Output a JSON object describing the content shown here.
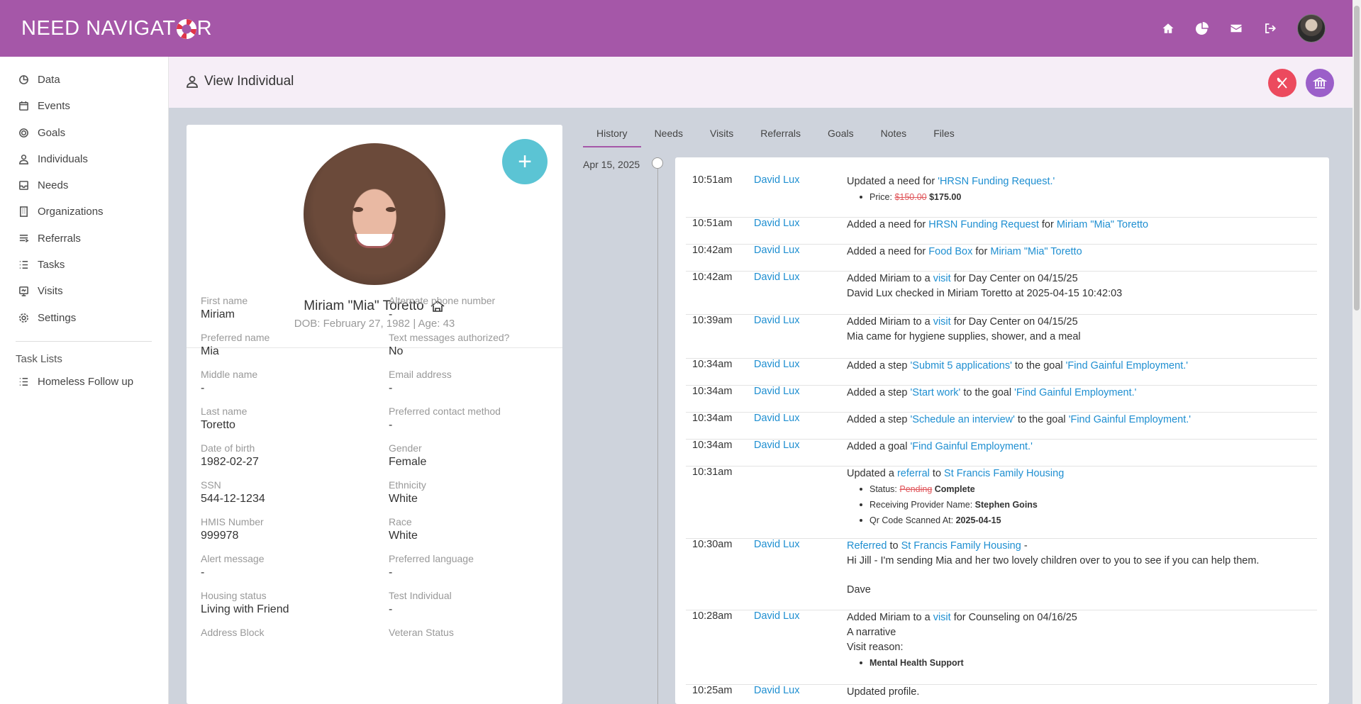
{
  "app": {
    "logo_text_left": "NEED NAVIGAT",
    "logo_text_right": "R",
    "accent_color": "#a557a8"
  },
  "topbar": {
    "icons": [
      "home-icon",
      "pie-chart-icon",
      "mail-icon",
      "logout-icon"
    ]
  },
  "sidebar": {
    "items": [
      {
        "label": "Data",
        "icon": "chart-icon"
      },
      {
        "label": "Events",
        "icon": "calendar-icon"
      },
      {
        "label": "Goals",
        "icon": "target-icon"
      },
      {
        "label": "Individuals",
        "icon": "user-icon"
      },
      {
        "label": "Needs",
        "icon": "inbox-icon"
      },
      {
        "label": "Organizations",
        "icon": "building-icon"
      },
      {
        "label": "Referrals",
        "icon": "referral-icon"
      },
      {
        "label": "Tasks",
        "icon": "list-icon"
      },
      {
        "label": "Visits",
        "icon": "visit-icon"
      },
      {
        "label": "Settings",
        "icon": "gear-icon"
      }
    ],
    "task_lists_title": "Task Lists",
    "task_lists": [
      {
        "label": "Homeless Follow up",
        "icon": "list-icon"
      }
    ]
  },
  "header": {
    "title": "View Individual"
  },
  "profile": {
    "name": "Miriam \"Mia\" Toretto",
    "dob_line": "DOB: February 27, 1982 | Age: 43",
    "add_button": "+",
    "fields_left": [
      {
        "label": "First name",
        "value": "Miriam"
      },
      {
        "label": "Preferred name",
        "value": "Mia"
      },
      {
        "label": "Middle name",
        "value": "-"
      },
      {
        "label": "Last name",
        "value": "Toretto"
      },
      {
        "label": "Date of birth",
        "value": "1982-02-27"
      },
      {
        "label": "SSN",
        "value": "544-12-1234"
      },
      {
        "label": "HMIS Number",
        "value": "999978"
      },
      {
        "label": "Alert message",
        "value": "-"
      },
      {
        "label": "Housing status",
        "value": "Living with Friend"
      },
      {
        "label": "Address Block",
        "value": ""
      }
    ],
    "fields_right": [
      {
        "label": "Alternate phone number",
        "value": "-"
      },
      {
        "label": "Text messages authorized?",
        "value": "No"
      },
      {
        "label": "Email address",
        "value": "-"
      },
      {
        "label": "Preferred contact method",
        "value": "-"
      },
      {
        "label": "Gender",
        "value": "Female"
      },
      {
        "label": "Ethnicity",
        "value": "White"
      },
      {
        "label": "Race",
        "value": "White"
      },
      {
        "label": "Preferred language",
        "value": "-"
      },
      {
        "label": "Test Individual",
        "value": "-"
      },
      {
        "label": "Veteran Status",
        "value": ""
      }
    ]
  },
  "tabs": [
    "History",
    "Needs",
    "Visits",
    "Referrals",
    "Goals",
    "Notes",
    "Files"
  ],
  "history": {
    "date": "Apr 15, 2025",
    "rows": [
      {
        "time": "10:51am",
        "user": "David Lux",
        "parts": [
          {
            "t": "Updated a need for "
          },
          {
            "t": "'HRSN Funding Request.'",
            "link": true
          }
        ],
        "bullets": [
          [
            {
              "t": "Price: "
            },
            {
              "t": "$150.00",
              "strike": true
            },
            {
              "t": " "
            },
            {
              "t": "$175.00",
              "bold": true
            }
          ]
        ]
      },
      {
        "time": "10:51am",
        "user": "David Lux",
        "parts": [
          {
            "t": "Added a need for "
          },
          {
            "t": "HRSN Funding Request",
            "link": true
          },
          {
            "t": " for "
          },
          {
            "t": "Miriam \"Mia\" Toretto",
            "link": true
          }
        ]
      },
      {
        "time": "10:42am",
        "user": "David Lux",
        "parts": [
          {
            "t": "Added a need for "
          },
          {
            "t": "Food Box",
            "link": true
          },
          {
            "t": " for "
          },
          {
            "t": "Miriam \"Mia\" Toretto",
            "link": true
          }
        ]
      },
      {
        "time": "10:42am",
        "user": "David Lux",
        "parts": [
          {
            "t": "Added Miriam to a "
          },
          {
            "t": "visit",
            "link": true
          },
          {
            "t": " for Day Center on 04/15/25"
          }
        ],
        "extra": [
          "David Lux checked in Miriam Toretto at 2025-04-15 10:42:03"
        ]
      },
      {
        "time": "10:39am",
        "user": "David Lux",
        "parts": [
          {
            "t": "Added Miriam to a "
          },
          {
            "t": "visit",
            "link": true
          },
          {
            "t": " for Day Center on 04/15/25"
          }
        ],
        "extra": [
          "Mia came for hygiene supplies, shower, and a meal"
        ]
      },
      {
        "time": "10:34am",
        "user": "David Lux",
        "parts": [
          {
            "t": "Added a step "
          },
          {
            "t": "'Submit 5 applications'",
            "link": true
          },
          {
            "t": " to the goal "
          },
          {
            "t": "'Find Gainful Employment.'",
            "link": true
          }
        ]
      },
      {
        "time": "10:34am",
        "user": "David Lux",
        "parts": [
          {
            "t": "Added a step "
          },
          {
            "t": "'Start work'",
            "link": true
          },
          {
            "t": " to the goal "
          },
          {
            "t": "'Find Gainful Employment.'",
            "link": true
          }
        ]
      },
      {
        "time": "10:34am",
        "user": "David Lux",
        "parts": [
          {
            "t": "Added a step "
          },
          {
            "t": "'Schedule an interview'",
            "link": true
          },
          {
            "t": " to the goal "
          },
          {
            "t": "'Find Gainful Employment.'",
            "link": true
          }
        ]
      },
      {
        "time": "10:34am",
        "user": "David Lux",
        "parts": [
          {
            "t": "Added a goal "
          },
          {
            "t": "'Find Gainful Employment.'",
            "link": true
          }
        ]
      },
      {
        "time": "10:31am",
        "user": "",
        "parts": [
          {
            "t": "Updated a "
          },
          {
            "t": "referral",
            "link": true
          },
          {
            "t": " to "
          },
          {
            "t": "St Francis Family Housing",
            "link": true
          }
        ],
        "bullets": [
          [
            {
              "t": "Status: "
            },
            {
              "t": "Pending",
              "strike": true
            },
            {
              "t": " "
            },
            {
              "t": "Complete",
              "bold": true
            }
          ],
          [
            {
              "t": "Receiving Provider Name: "
            },
            {
              "t": "Stephen Goins",
              "bold": true
            }
          ],
          [
            {
              "t": "Qr Code Scanned At: "
            },
            {
              "t": "2025-04-15",
              "bold": true
            }
          ]
        ]
      },
      {
        "time": "10:30am",
        "user": "David Lux",
        "parts": [
          {
            "t": "Referred",
            "link": true
          },
          {
            "t": " to "
          },
          {
            "t": "St Francis Family Housing",
            "link": true
          },
          {
            "t": " -"
          }
        ],
        "extra": [
          "Hi Jill - I'm sending Mia and her two lovely children over to you to see if you can help them.",
          "",
          "Dave"
        ]
      },
      {
        "time": "10:28am",
        "user": "David Lux",
        "parts": [
          {
            "t": "Added Miriam to a "
          },
          {
            "t": "visit",
            "link": true
          },
          {
            "t": " for Counseling on 04/16/25"
          }
        ],
        "extra": [
          "A narrative",
          "Visit reason:"
        ],
        "bullets": [
          [
            {
              "t": "Mental Health Support",
              "bold": true
            }
          ]
        ]
      },
      {
        "time": "10:25am",
        "user": "David Lux",
        "parts": [
          {
            "t": "Updated profile."
          }
        ]
      }
    ]
  }
}
